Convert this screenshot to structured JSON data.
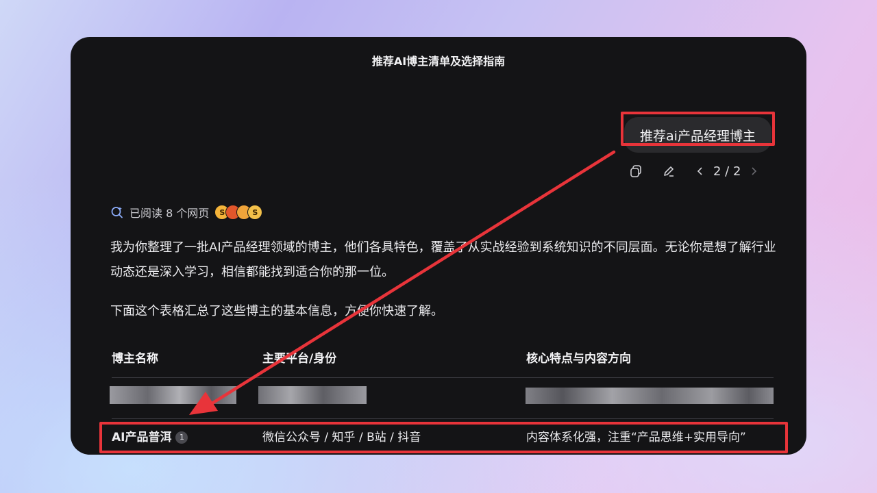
{
  "window": {
    "title": "推荐AI博主清单及选择指南"
  },
  "user_message": {
    "text": "推荐ai产品经理博主",
    "pager": "2 / 2"
  },
  "sources": {
    "label": "已阅读 8 个网页",
    "favicons": [
      "S",
      "",
      "",
      "S"
    ]
  },
  "answer": {
    "paragraph_1": "我为你整理了一批AI产品经理领域的博主，他们各具特色，覆盖了从实战经验到系统知识的不同层面。无论你是想了解行业动态还是深入学习，相信都能找到适合你的那一位。",
    "paragraph_2": "下面这个表格汇总了这些博主的基本信息，方便你快速了解。"
  },
  "table": {
    "headers": [
      "博主名称",
      "主要平台/身份",
      "核心特点与内容方向"
    ],
    "rows": [
      {
        "name": "AI产品普洱",
        "citation": "1",
        "platform": "微信公众号 / 知乎 / B站 / 抖音",
        "feature": "内容体系化强，注重“产品思维+实用导向”"
      }
    ]
  },
  "colors": {
    "highlight": "#e8343a",
    "panel": "#141416"
  }
}
